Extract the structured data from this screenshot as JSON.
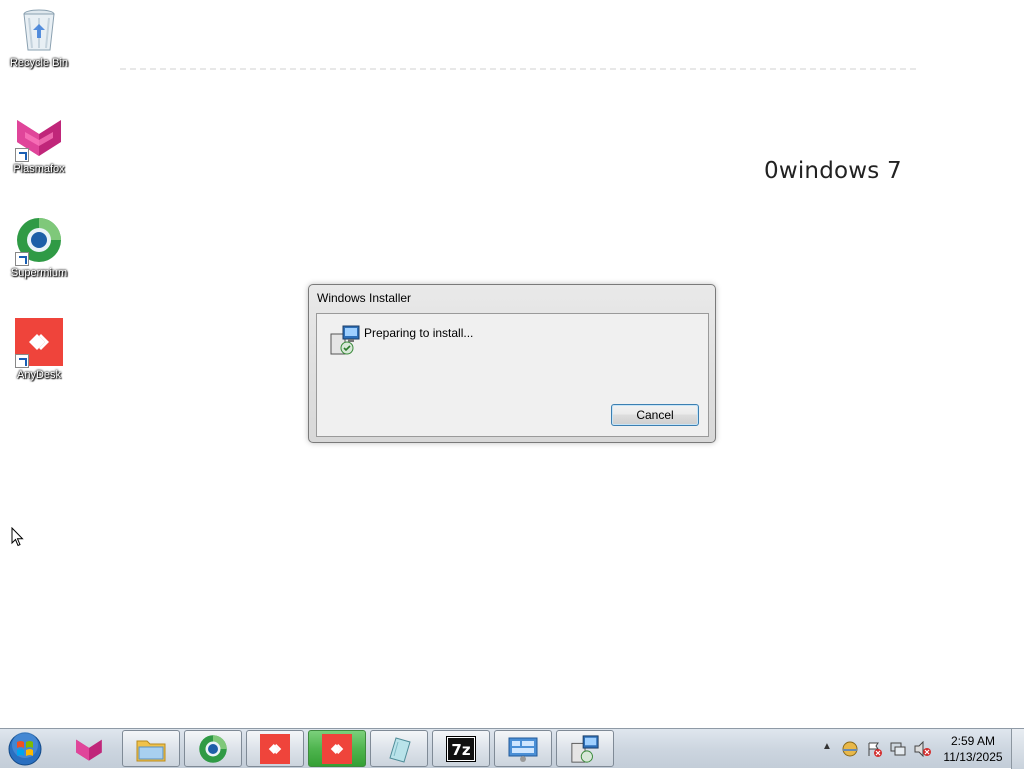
{
  "desktop": {
    "watermark": "0windows 7",
    "icons": [
      {
        "label": "Recycle Bin",
        "icon": "recycle-bin-icon"
      },
      {
        "label": "Plasmafox",
        "icon": "plasmafox-icon"
      },
      {
        "label": "Supermium",
        "icon": "supermium-icon"
      },
      {
        "label": "AnyDesk",
        "icon": "anydesk-icon"
      }
    ]
  },
  "dialog": {
    "title": "Windows Installer",
    "message": "Preparing to install...",
    "cancel_label": "Cancel",
    "icon": "installer-icon"
  },
  "taskbar": {
    "start_icon": "windows-start-orb-icon",
    "buttons": [
      {
        "icon": "plasmafox-icon",
        "state": "pinned"
      },
      {
        "icon": "file-explorer-icon",
        "state": "open"
      },
      {
        "icon": "supermium-icon",
        "state": "open"
      },
      {
        "icon": "anydesk-icon",
        "state": "open"
      },
      {
        "icon": "anydesk-icon",
        "state": "active"
      },
      {
        "icon": "notepad-icon",
        "state": "open"
      },
      {
        "icon": "7zip-icon",
        "state": "open"
      },
      {
        "icon": "control-panel-icon",
        "state": "open"
      },
      {
        "icon": "installer-icon",
        "state": "open"
      }
    ],
    "tray": {
      "icons": [
        "show-hidden-icons-chevron",
        "network-icon",
        "action-center-icon",
        "network-disconnected-icon",
        "volume-muted-icon"
      ],
      "time": "2:59 AM",
      "date": "11/13/2025"
    }
  },
  "colors": {
    "desktop_bg": "#ffffff",
    "anydesk_red": "#ef443b",
    "plasmafox_magenta": "#c0267a",
    "button_focus_border": "#3c7fb1"
  }
}
